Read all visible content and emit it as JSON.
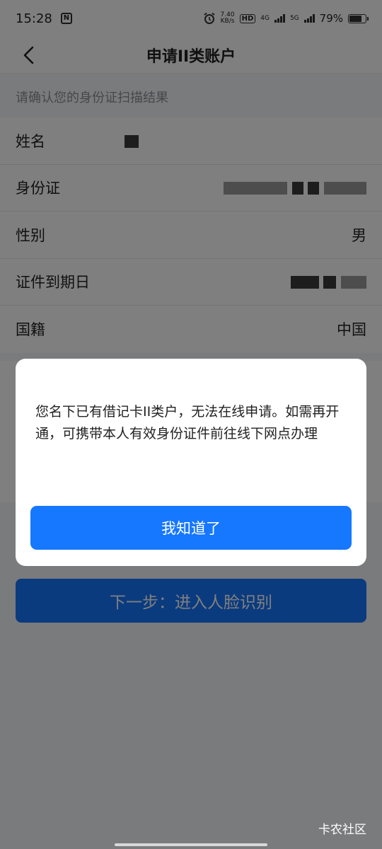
{
  "status_bar": {
    "time": "15:28",
    "nfc_label": "N",
    "net_speed_value": "7.40",
    "net_speed_unit": "KB/s",
    "hd_label": "HD",
    "sim1_network": "4G",
    "sim2_network": "5G",
    "battery_percent": "79%",
    "battery_level": 0.79
  },
  "nav": {
    "title": "申请II类账户"
  },
  "form": {
    "hint": "请确认您的身份证扫描结果",
    "rows": [
      {
        "label": "姓名",
        "value": ""
      },
      {
        "label": "身份证",
        "value": ""
      },
      {
        "label": "性别",
        "value": "男"
      },
      {
        "label": "证件到期日",
        "value": ""
      },
      {
        "label": "国籍",
        "value": "中国"
      }
    ]
  },
  "next_button": {
    "label": "下一步：进入人脸识别"
  },
  "dialog": {
    "message": "您名下已有借记卡II类户，无法在线申请。如需再开通，可携带本人有效身份证件前往线下网点办理",
    "confirm_label": "我知道了"
  },
  "watermark": "卡农社区",
  "colors": {
    "primary": "#1677ff",
    "overlay": "rgba(0,0,0,0.5)",
    "hint_text": "#8a8f99"
  }
}
